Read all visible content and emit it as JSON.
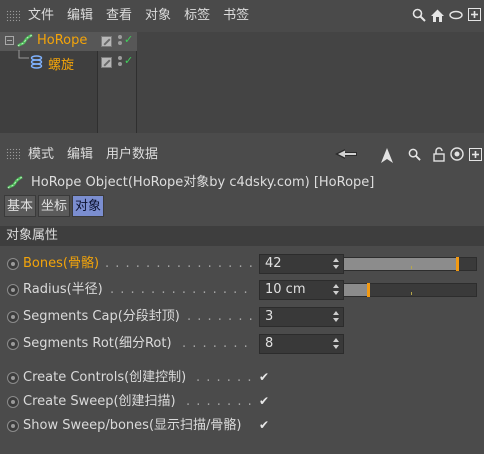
{
  "object_manager": {
    "menu": [
      "文件",
      "编辑",
      "查看",
      "对象",
      "标签",
      "书签"
    ],
    "objects": [
      {
        "name": "HoRope",
        "color": "#f3a40a",
        "selected": true,
        "visible_check": "✓"
      },
      {
        "name": "螺旋",
        "color": "#f3a40a",
        "selected": false,
        "visible_check": "✓"
      }
    ]
  },
  "attribute_manager": {
    "menu": [
      "模式",
      "编辑",
      "用户数据"
    ],
    "title": "HoRope Object(HoRope对象by c4dsky.com) [HoRope]",
    "tabs": [
      {
        "label": "基本",
        "active": false
      },
      {
        "label": "坐标",
        "active": false
      },
      {
        "label": "对象",
        "active": true
      }
    ],
    "section": "对象属性",
    "params": {
      "bones": {
        "label": "Bones(骨骼)",
        "leader": ". . . . . . . . . . . . . . . . . . . . .",
        "value": "42",
        "slider": 0.85,
        "highlight": true
      },
      "radius": {
        "label": "Radius(半径)",
        "leader": ". . . . . . . . . . . . . . . . . . . . .",
        "value": "10 cm",
        "slider": 0.18,
        "highlight": false
      },
      "segments_cap": {
        "label": "Segments Cap(分段封顶)",
        "leader": ". . . . . . . . . . .",
        "value": "3"
      },
      "segments_rot": {
        "label": "Segments Rot(细分Rot)",
        "leader": ". . . . . . . . . . .",
        "value": "8"
      },
      "create_controls": {
        "label": "Create Controls(创建控制)",
        "leader": ". . . . . . . . .",
        "checked": "✔"
      },
      "create_sweep": {
        "label": "Create Sweep(创建扫描)",
        "leader": ". . . . . . . . . .",
        "checked": "✔"
      },
      "show_sweep": {
        "label": "Show Sweep/bones(显示扫描/骨骼)",
        "leader": "",
        "checked": "✔"
      }
    }
  },
  "icons": {
    "search": "search-icon",
    "home": "home-icon",
    "maximize": "maximize-icon",
    "back": "back-arrow-icon",
    "cursor": "cursor-icon",
    "lock": "lock-icon",
    "target": "target-icon"
  },
  "colors": {
    "accent_orange": "#f3a40a",
    "tab_active": "#7b8ed0",
    "check_green": "#3fd05a"
  }
}
